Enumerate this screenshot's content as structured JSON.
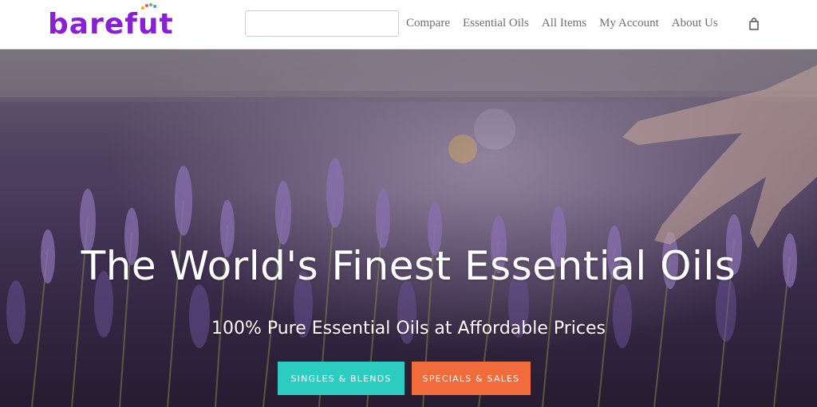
{
  "brand": {
    "logo_pre": "bare",
    "logo_o": "f",
    "logo_post": "ut",
    "logo_color": "#8a1fd6"
  },
  "search": {
    "placeholder": "",
    "value": ""
  },
  "nav": {
    "items": [
      {
        "label": "Compare"
      },
      {
        "label": "Essential Oils"
      },
      {
        "label": "All Items"
      },
      {
        "label": "My Account"
      },
      {
        "label": "About Us"
      }
    ],
    "cart_icon": "shopping-bag-icon"
  },
  "hero": {
    "title": "The World's Finest Essential Oils",
    "subtitle": "100% Pure Essential Oils at Affordable Prices",
    "buttons": {
      "singles": {
        "label": "SINGLES & BLENDS",
        "color": "#2ccdc0"
      },
      "specials": {
        "label": "SPECIALS & SALES",
        "color": "#f26b3a"
      }
    }
  }
}
